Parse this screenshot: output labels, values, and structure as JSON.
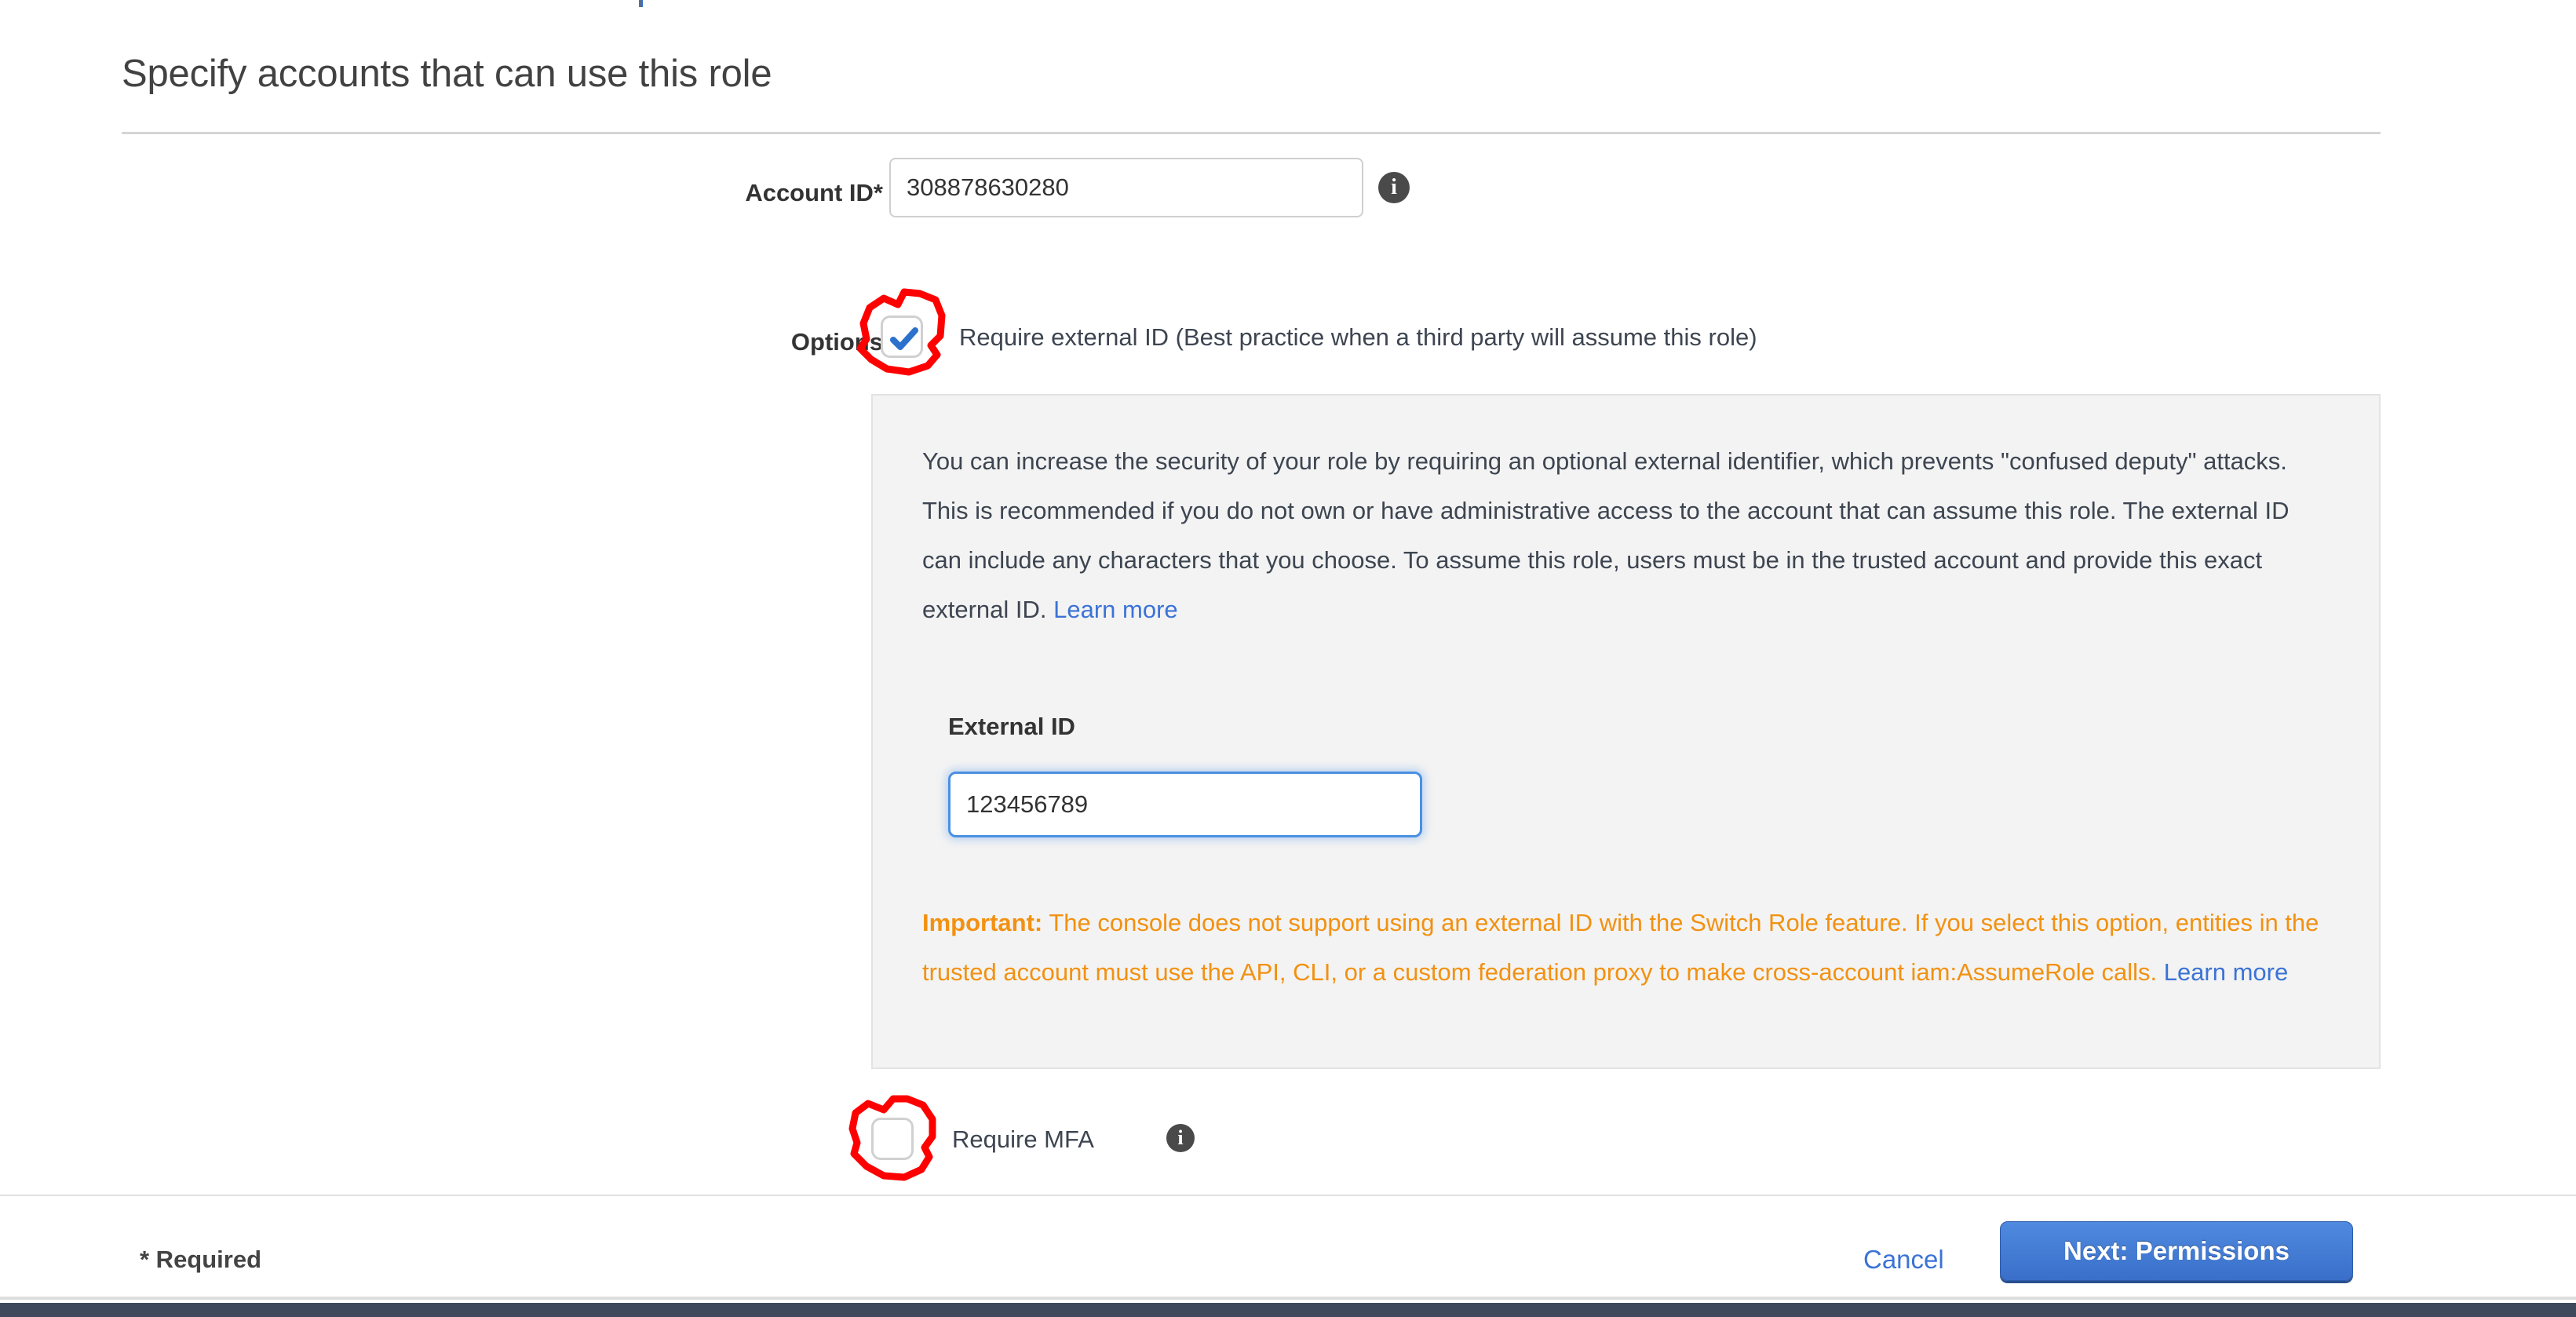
{
  "page": {
    "title": "Specify accounts that can use this role"
  },
  "form": {
    "account_id": {
      "label": "Account ID*",
      "value": "308878630280",
      "placeholder": "",
      "info_icon": "info-icon"
    },
    "options": {
      "label": "Options",
      "require_external_id": {
        "checkbox_label": "Require external ID (Best practice when a third party will assume this role)",
        "checked": true,
        "annotation": "red-hand-drawn-circle"
      },
      "require_mfa": {
        "checkbox_label": "Require MFA",
        "checked": false,
        "info_icon": "info-icon",
        "annotation": "red-hand-drawn-circle"
      }
    },
    "info_panel": {
      "body_part1": "You can increase the security of your role by requiring an optional external identifier, which prevents \"confused deputy\" attacks. This is recommended if you do not own or have administrative access to the account that can assume this role. The external ID can include any characters that you choose. To assume this role, users must be in the trusted account and provide this exact external ID. ",
      "learn_more": "Learn more",
      "external_id": {
        "label": "External ID",
        "value": "123456789",
        "placeholder": "",
        "focused": true
      },
      "warning": {
        "prefix": "Important:",
        "body": " The console does not support using an external ID with the Switch Role feature. If you select this option, entities in the trusted account must use the API, CLI, or a custom federation proxy to make cross-account iam:AssumeRole calls. ",
        "learn_more": "Learn more"
      }
    }
  },
  "footer": {
    "required_note": "* Required",
    "cancel_label": "Cancel",
    "next_label": "Next: Permissions"
  },
  "colors": {
    "link": "#3b73d6",
    "warning": "#f29111",
    "primary_button": "#3a6fc9",
    "annotation": "#ff0000",
    "panel_background": "#f3f3f3",
    "bottom_bar": "#3e4a5c"
  }
}
